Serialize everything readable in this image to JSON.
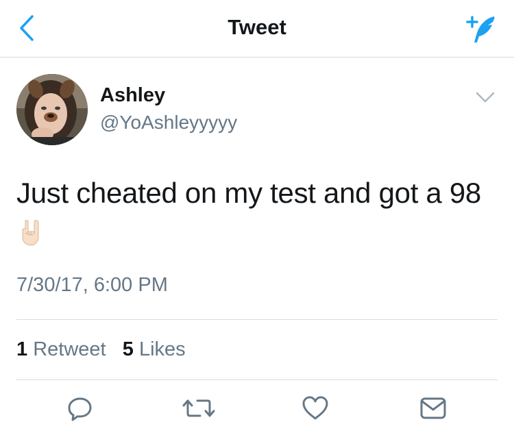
{
  "nav": {
    "title": "Tweet",
    "back_icon": "chevron-left-icon",
    "compose_icon": "compose-tweet-icon",
    "accent_color": "#1da1f2"
  },
  "tweet": {
    "author_name": "Ashley",
    "author_handle": "@YoAshleyyyyy",
    "text": "Just cheated on my test and got a 98",
    "emoji": "sign-of-the-horns-emoji",
    "timestamp": "7/30/17, 6:00 PM",
    "stats": {
      "retweets_count": "1",
      "retweets_label": "Retweet",
      "likes_count": "5",
      "likes_label": "Likes"
    }
  },
  "actions": [
    "reply-icon",
    "retweet-icon",
    "like-icon",
    "message-icon"
  ],
  "colors": {
    "text_primary": "#14171a",
    "text_secondary": "#657786",
    "icon_gray": "#657786",
    "divider": "#dcdcdc"
  }
}
